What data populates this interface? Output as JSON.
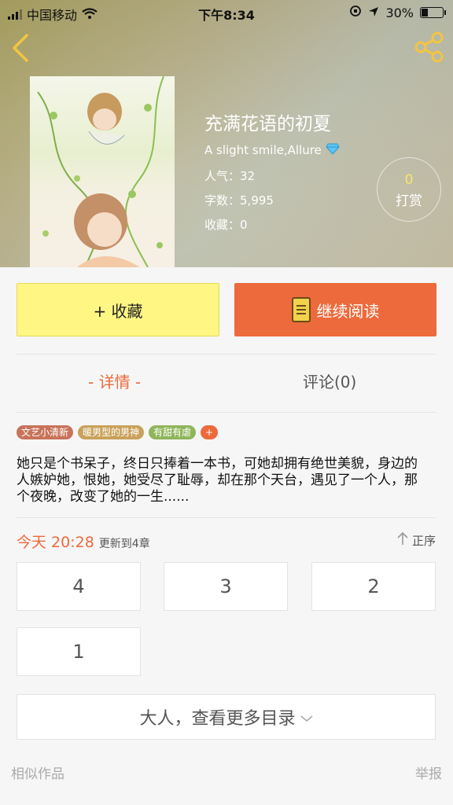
{
  "status_bar": {
    "carrier": "中国移动",
    "time": "下午8:34",
    "battery": "30%",
    "battery_level": 0.3
  },
  "nav": {
    "back_icon": "chevron-left-icon",
    "share_icon": "share-icon"
  },
  "book": {
    "title": "充满花语的初夏",
    "author": "A slight smile,Allure",
    "author_badge_icon": "diamond-icon",
    "popularity_label": "人气：",
    "popularity": "32",
    "wordcount_label": "字数：",
    "wordcount": "5,995",
    "favorites_label": "收藏：",
    "favorites": "0"
  },
  "reward": {
    "count": "0",
    "label": "打赏"
  },
  "actions": {
    "favorite_label": "+ 收藏",
    "read_label": "继续阅读"
  },
  "tabs": [
    {
      "label": "- 详情 -",
      "active": true
    },
    {
      "label": "评论(0)",
      "active": false
    }
  ],
  "tags": [
    {
      "label": "文艺小清新",
      "color": "#c8735a"
    },
    {
      "label": "暖男型的男神",
      "color": "#c9a15a"
    },
    {
      "label": "有甜有虐",
      "color": "#8fb55a"
    },
    {
      "label": "+",
      "color": "#ec6a3b"
    }
  ],
  "synopsis": "她只是个书呆子，终日只捧着一本书，可她却拥有绝世美貌，身边的人嫉妒她，恨她，她受尽了耻辱，却在那个天台，遇见了一个人，那个夜晚，改变了她的一生......",
  "update": {
    "time": "今天 20:28",
    "text": "更新到4章"
  },
  "sort": {
    "label": "正序"
  },
  "chapters": [
    "4",
    "3",
    "2",
    "1"
  ],
  "more_catalog": "大人，查看更多目录",
  "footer": {
    "similar": "相似作品",
    "report": "举报"
  },
  "colors": {
    "accent": "#ec6a3b",
    "favorite_bg": "#fff683"
  }
}
